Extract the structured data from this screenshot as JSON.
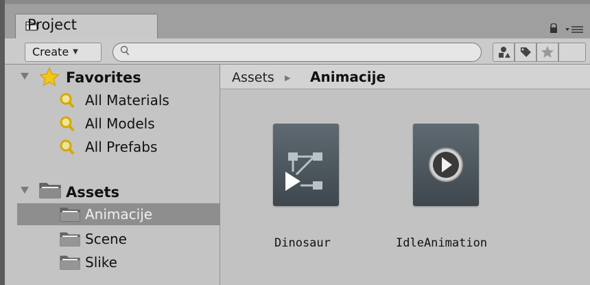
{
  "window": {
    "tab_title": "Project"
  },
  "toolbar": {
    "create_label": "Create",
    "search_placeholder": "",
    "icons": [
      "filter-by-type-icon",
      "filter-by-label-icon",
      "favorite-star-icon"
    ]
  },
  "tree": {
    "favorites": {
      "label": "Favorites",
      "items": [
        "All Materials",
        "All Models",
        "All Prefabs"
      ]
    },
    "assets": {
      "label": "Assets",
      "items": [
        "Animacije",
        "Scene",
        "Slike"
      ],
      "selected": "Animacije"
    }
  },
  "breadcrumb": {
    "root": "Assets",
    "current": "Animacije"
  },
  "assets_grid": [
    {
      "name": "Dinosaur",
      "icon": "animator-controller-icon"
    },
    {
      "name": "IdleAnimation",
      "icon": "animation-clip-icon"
    }
  ],
  "colors": {
    "selection": "#8e8e8e",
    "tile": "#4f5a61",
    "star": "#f5c518",
    "search_icon": "#e2b400"
  }
}
